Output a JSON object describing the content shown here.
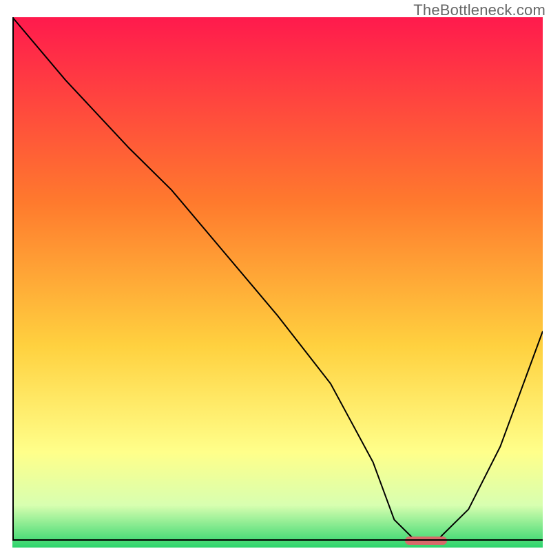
{
  "watermark": "TheBottleneck.com",
  "colors": {
    "gradient_top": "#ff1a4d",
    "gradient_mid1": "#ff7a2d",
    "gradient_mid2": "#ffd13f",
    "gradient_mid3": "#ffff8a",
    "gradient_bottom": "#2cd46c",
    "curve": "#000000",
    "marker": "#d86a6a",
    "axis": "#000000"
  },
  "chart_data": {
    "type": "line",
    "title": "",
    "xlabel": "",
    "ylabel": "",
    "xlim": [
      0,
      100
    ],
    "ylim": [
      0,
      100
    ],
    "series": [
      {
        "name": "bottleneck-curve",
        "x": [
          0,
          10,
          22,
          30,
          40,
          50,
          60,
          68,
          72,
          76,
          80,
          86,
          92,
          100
        ],
        "y": [
          100,
          88,
          75,
          67,
          55,
          43,
          30,
          15,
          4,
          0,
          0,
          6,
          18,
          40
        ]
      }
    ],
    "annotations": [
      {
        "name": "optimal-marker",
        "x_start": 74,
        "x_end": 82,
        "y": 0
      }
    ],
    "gradient_stops_pct": [
      0,
      35,
      62,
      82,
      92,
      100
    ]
  }
}
